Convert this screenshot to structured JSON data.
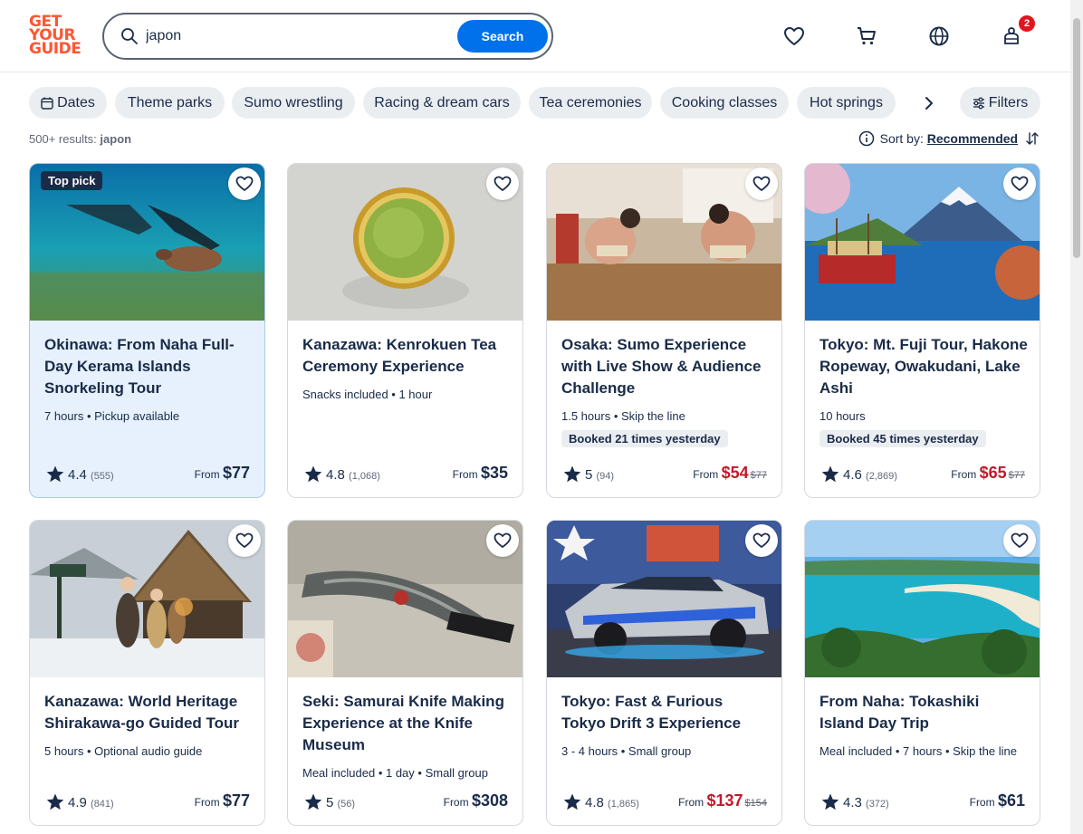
{
  "brand": {
    "line1": "GET",
    "line2": "YOUR",
    "line3": "GUIDE",
    "color": "#ff5533"
  },
  "search": {
    "value": "japon",
    "button": "Search"
  },
  "header": {
    "cart_count": "2"
  },
  "chips": [
    "Dates",
    "Theme parks",
    "Sumo wrestling",
    "Racing & dream cars",
    "Tea ceremonies",
    "Cooking classes",
    "Hot springs",
    "Filters"
  ],
  "results": {
    "count": "500+ results:",
    "query": "japon"
  },
  "sort": {
    "label": "Sort by:",
    "value": "Recommended"
  },
  "cards": [
    {
      "badge": "Top pick",
      "title": "Okinawa: From Naha Full-Day Kerama Islands Snorkeling Tour",
      "meta": "7 hours • Pickup available",
      "booked": "",
      "rating": "4.4",
      "reviews": "(555)",
      "from": "From",
      "price": "$77",
      "old": ""
    },
    {
      "badge": "",
      "title": "Kanazawa: Kenrokuen Tea Ceremony Experience",
      "meta": "Snacks included • 1 hour",
      "booked": "",
      "rating": "4.8",
      "reviews": "(1,068)",
      "from": "From",
      "price": "$35",
      "old": ""
    },
    {
      "badge": "",
      "title": "Osaka: Sumo Experience with Live Show & Audience Challenge",
      "meta": "1.5 hours • Skip the line",
      "booked": "Booked 21 times yesterday",
      "rating": "5",
      "reviews": "(94)",
      "from": "From",
      "price": "$54",
      "old": "$77"
    },
    {
      "badge": "",
      "title": "Tokyo: Mt. Fuji Tour, Hakone Ropeway, Owakudani, Lake Ashi",
      "meta": "10 hours",
      "booked": "Booked 45 times yesterday",
      "rating": "4.6",
      "reviews": "(2,869)",
      "from": "From",
      "price": "$65",
      "old": "$77"
    },
    {
      "badge": "",
      "title": "Kanazawa: World Heritage Shirakawa-go Guided Tour",
      "meta": "5 hours • Optional audio guide",
      "booked": "",
      "rating": "4.9",
      "reviews": "(841)",
      "from": "From",
      "price": "$77",
      "old": ""
    },
    {
      "badge": "",
      "title": "Seki: Samurai Knife Making Experience at the Knife Museum",
      "meta": "Meal included • 1 day • Small group",
      "booked": "",
      "rating": "5",
      "reviews": "(56)",
      "from": "From",
      "price": "$308",
      "old": ""
    },
    {
      "badge": "",
      "title": "Tokyo: Fast & Furious Tokyo Drift 3 Experience",
      "meta": "3 - 4 hours • Small group",
      "booked": "",
      "rating": "4.8",
      "reviews": "(1,865)",
      "from": "From",
      "price": "$137",
      "old": "$154"
    },
    {
      "badge": "",
      "title": "From Naha: Tokashiki Island Day Trip",
      "meta": "Meal included • 7 hours • Skip the line",
      "booked": "",
      "rating": "4.3",
      "reviews": "(372)",
      "from": "From",
      "price": "$61",
      "old": ""
    }
  ]
}
